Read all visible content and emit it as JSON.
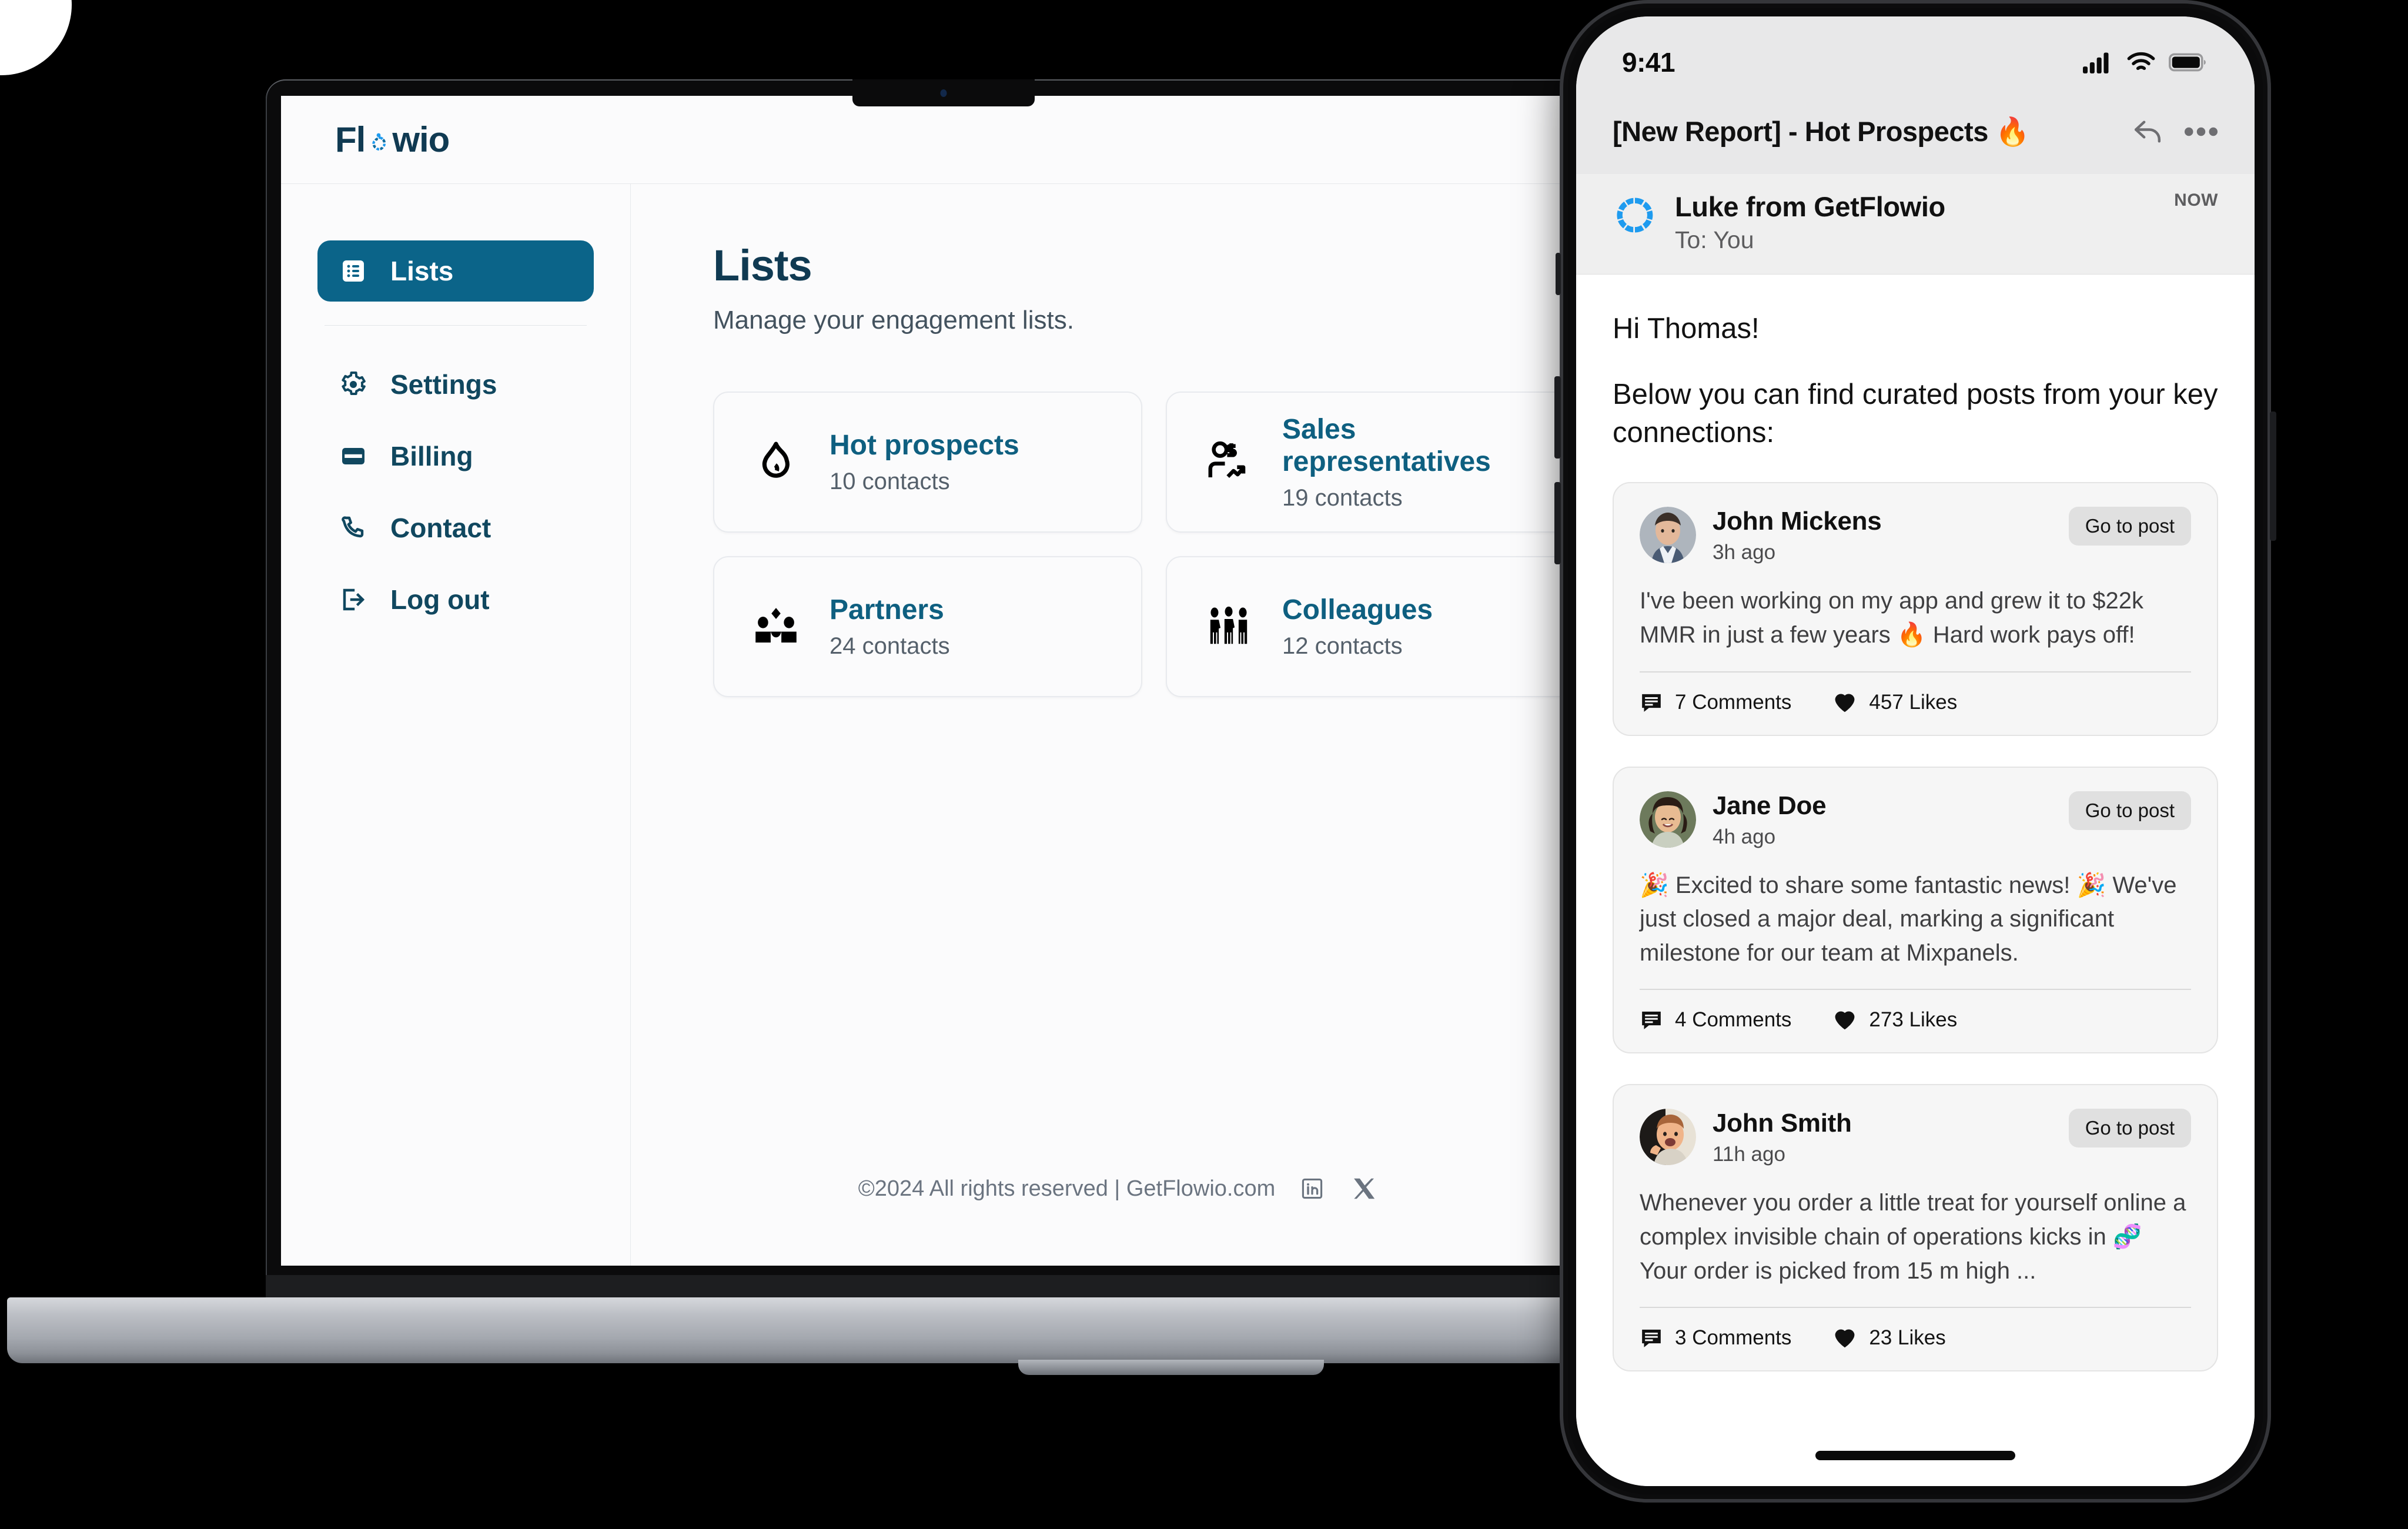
{
  "desktop": {
    "logo": {
      "text_before": "Fl",
      "text_after": "wio",
      "ring_icon": "flowio-ring-icon"
    },
    "sidebar": {
      "primary": [
        {
          "label": "Lists",
          "icon": "list-icon",
          "active": true
        }
      ],
      "secondary": [
        {
          "label": "Settings",
          "icon": "gear-icon"
        },
        {
          "label": "Billing",
          "icon": "credit-card-icon"
        },
        {
          "label": "Contact",
          "icon": "phone-icon"
        },
        {
          "label": "Log out",
          "icon": "logout-icon"
        }
      ]
    },
    "main": {
      "title": "Lists",
      "subtitle": "Manage your engagement lists.",
      "cards": [
        {
          "title": "Hot prospects",
          "count": "10 contacts",
          "icon": "flame-icon"
        },
        {
          "title": "Sales representatives",
          "count": "19 contacts",
          "icon": "person-dollar-chart-icon"
        },
        {
          "title": "Partners",
          "count": "24 contacts",
          "icon": "handshake-people-icon"
        },
        {
          "title": "Colleagues",
          "count": "12 contacts",
          "icon": "three-people-icon"
        }
      ]
    },
    "footer": {
      "text": "©2024 All rights reserved | GetFlowio.com",
      "social": [
        {
          "name": "linkedin-icon",
          "label": "in"
        },
        {
          "name": "x-twitter-icon",
          "label": "X"
        }
      ]
    }
  },
  "phone": {
    "status": {
      "time": "9:41",
      "icons": [
        "cellular-signal-icon",
        "wifi-icon",
        "battery-icon"
      ]
    },
    "mail": {
      "subject": "[New Report] - Hot Prospects 🔥",
      "actions": [
        {
          "name": "reply-icon"
        },
        {
          "name": "more-options-icon"
        }
      ],
      "sender": {
        "name": "Luke from GetFlowio",
        "to": "To: You",
        "timestamp": "NOW",
        "avatar_icon": "flowio-ring-icon"
      },
      "body": {
        "greeting": "Hi Thomas!",
        "intro": "Below you can find curated posts from your key connections:"
      },
      "posts": [
        {
          "name": "John Mickens",
          "time": "3h ago",
          "cta": "Go to post",
          "text": "I've been working on my app and grew it to $22k MMR in just a few years 🔥 Hard work pays off!",
          "comments": "7 Comments",
          "likes": "457 Likes"
        },
        {
          "name": "Jane Doe",
          "time": "4h ago",
          "cta": "Go to post",
          "text": "🎉 Excited to share some fantastic news! 🎉 We've just closed a major deal, marking a significant milestone for our team at Mixpanels.",
          "comments": "4 Comments",
          "likes": "273 Likes"
        },
        {
          "name": "John Smith",
          "time": "11h ago",
          "cta": "Go to post",
          "text": "Whenever you order a little treat for yourself online a complex invisible chain of operations kicks in 🧬 Your order is picked from 15 m high ...",
          "comments": "3 Comments",
          "likes": "23 Likes"
        }
      ]
    }
  },
  "colors": {
    "brand_dark": "#103a52",
    "brand_active": "#0b6489",
    "brand_link": "#0e5f80",
    "logo_accent": "#1e9bef",
    "app_bg": "#fbfbfc",
    "phone_chrome": "#e8e8e9"
  }
}
